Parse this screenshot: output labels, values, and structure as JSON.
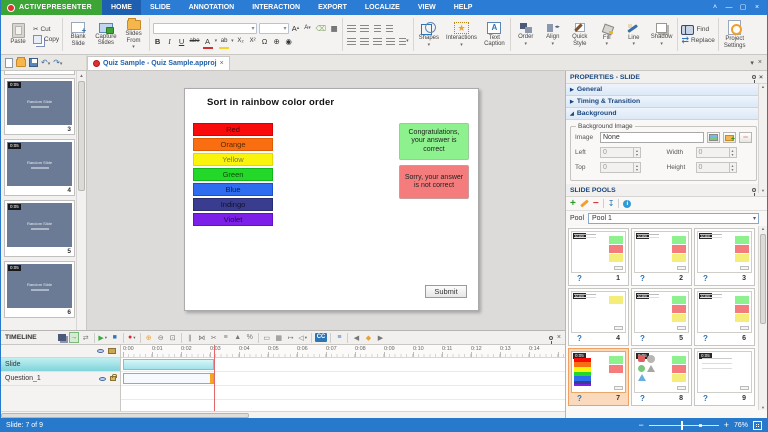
{
  "colors": {
    "titlebar_blue": "#2B7CD5",
    "brand_green": "#3DA535",
    "active_tab_blue": "#1F5FB0",
    "statusbar_blue": "#2779CB",
    "selected_pool_bg": "#FBD9BD",
    "selected_pool_border": "#F0A060"
  },
  "titlebar": {
    "app_name": "ACTIVEPRESENTER",
    "tabs": [
      {
        "label": "HOME"
      },
      {
        "label": "SLIDE"
      },
      {
        "label": "ANNOTATION"
      },
      {
        "label": "INTERACTION"
      },
      {
        "label": "EXPORT"
      },
      {
        "label": "LOCALIZE"
      },
      {
        "label": "VIEW"
      },
      {
        "label": "HELP"
      }
    ],
    "active_tab": "HOME"
  },
  "ribbon": {
    "paste": "Paste",
    "cut": "Cut",
    "copy": "Copy",
    "blank_slide": "Blank\nSlide",
    "capture_slides": "Capture\nSlides",
    "slides_from": "Slides\nFrom",
    "bold": "B",
    "italic": "I",
    "underline": "U",
    "strikethrough": "abe",
    "font_color": "A",
    "subscript": "X₂",
    "superscript": "X²",
    "symbol": "Ω",
    "shapes": "Shapes",
    "interactions": "Interactions",
    "text_caption": "Text\nCaption",
    "order": "Order",
    "align": "Align",
    "quick_style": "Quick\nStyle",
    "fill": "Fill",
    "line": "Line",
    "shadow": "Shadow",
    "find": "Find",
    "replace": "Replace",
    "project_settings": "Project\nSettings"
  },
  "document_tab": {
    "title": "Quiz Sample - Quiz Sample.approj",
    "close": "×"
  },
  "slide_panel": {
    "caption": "Random Slide",
    "slides": [
      {
        "duration": "0:05",
        "number": "3"
      },
      {
        "duration": "0:05",
        "number": "4"
      },
      {
        "duration": "0:05",
        "number": "5"
      },
      {
        "duration": "0:05",
        "number": "6"
      }
    ]
  },
  "canvas": {
    "title": "Sort in rainbow color order",
    "bars": [
      {
        "label": "Red",
        "bg": "#F90B0B",
        "border": "#D80000",
        "text": "#4A0A0A"
      },
      {
        "label": "Orange",
        "bg": "#FA6E12",
        "border": "#E05A00",
        "text": "#5A2A00"
      },
      {
        "label": "Yellow",
        "bg": "#FAF40C",
        "border": "#E0DA00",
        "text": "#77774A"
      },
      {
        "label": "Green",
        "bg": "#23D829",
        "border": "#10B818",
        "text": "#0A4A0A"
      },
      {
        "label": "Blue",
        "bg": "#2E6CF0",
        "border": "#1A50D0",
        "text": "#0A1A50"
      },
      {
        "label": "Indingo",
        "bg": "#3A3D8F",
        "border": "#2A2C70",
        "text": "#10102E"
      },
      {
        "label": "Violet",
        "bg": "#7C1FE8",
        "border": "#6410C8",
        "text": "#24084A"
      }
    ],
    "feedback_correct": {
      "text": "Congratulations, your answer is correct",
      "bg": "#8DF18D",
      "border": "#9ACB9A"
    },
    "feedback_incorrect": {
      "text": "Sorry, your answer is not correct",
      "bg": "#F47C7C",
      "border": "#CB9A9A"
    },
    "submit": "Submit"
  },
  "properties": {
    "title": "PROPERTIES - SLIDE",
    "sections": [
      {
        "label": "General"
      },
      {
        "label": "Timing & Transition"
      },
      {
        "label": "Background"
      }
    ],
    "background_image": {
      "group_label": "Background Image",
      "image_label": "Image",
      "image_value": "None",
      "left_label": "Left",
      "left_value": "0",
      "width_label": "Width",
      "width_value": "0",
      "top_label": "Top",
      "top_value": "0",
      "height_label": "Height",
      "height_value": "0"
    }
  },
  "slide_pools": {
    "title": "SLIDE POOLS",
    "pool_label": "Pool",
    "pool_value": "Pool 1",
    "thumbnails": [
      {
        "duration": "0:05",
        "question": "?",
        "number": "1"
      },
      {
        "duration": "0:05",
        "question": "?",
        "number": "2"
      },
      {
        "duration": "0:05",
        "question": "?",
        "number": "3"
      },
      {
        "duration": "0:05",
        "question": "?",
        "number": "4"
      },
      {
        "duration": "0:05",
        "question": "?",
        "number": "5"
      },
      {
        "duration": "0:05",
        "question": "?",
        "number": "6"
      },
      {
        "duration": "0:05",
        "question": "?",
        "number": "7"
      },
      {
        "duration": "0:05",
        "question": "?",
        "number": "8"
      },
      {
        "duration": "0:05",
        "question": "?",
        "number": "9"
      }
    ],
    "selected_number": "7"
  },
  "timeline": {
    "title": "TIMELINE",
    "cc_label": "CC",
    "tracks": [
      {
        "name": "Slide"
      },
      {
        "name": "Question_1"
      }
    ],
    "ruler_labels": [
      "0:00",
      "0:01",
      "0:02",
      "0:03",
      "0:04",
      "0:05",
      "0:06",
      "0:07",
      "0:08",
      "0:09",
      "0:10",
      "0:11",
      "0:12",
      "0:13",
      "0:14"
    ]
  },
  "statusbar": {
    "slide_info": "Slide: 7 of 9",
    "zoom_percent": "76%"
  }
}
